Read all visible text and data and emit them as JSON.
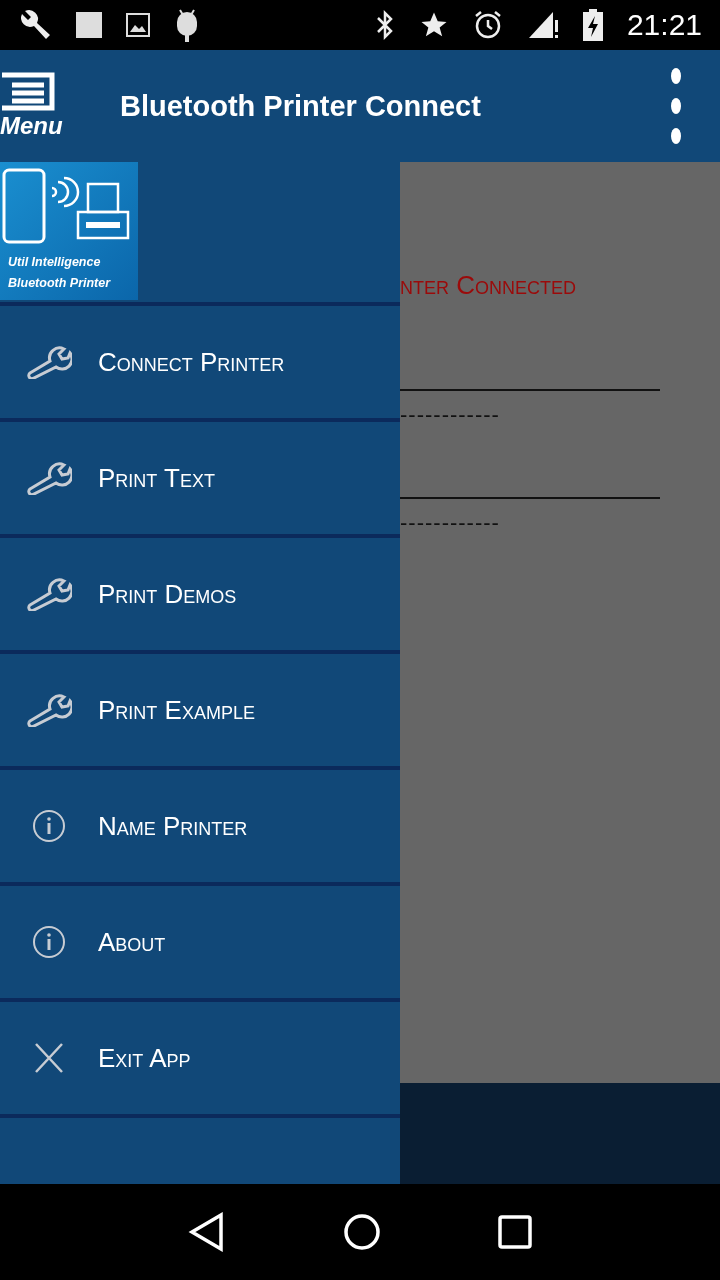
{
  "status_bar": {
    "time": "21:21"
  },
  "app_bar": {
    "menu_label": "Menu",
    "title": "Bluetooth Printer Connect"
  },
  "content": {
    "status": "nter Connected",
    "rows": [
      {
        "dashes": "------------"
      },
      {
        "dashes": "------------"
      }
    ]
  },
  "drawer": {
    "logo": {
      "line_1": "Util Intelligence",
      "line_2": "Bluetooth Printer"
    },
    "items": [
      {
        "kind": "wrench",
        "label": "Connect Printer"
      },
      {
        "kind": "wrench",
        "label": "Print Text"
      },
      {
        "kind": "wrench",
        "label": "Print Demos"
      },
      {
        "kind": "wrench",
        "label": "Print Example"
      },
      {
        "kind": "info",
        "label": "Name Printer"
      },
      {
        "kind": "info",
        "label": "About"
      },
      {
        "kind": "close",
        "label": "Exit App"
      }
    ]
  }
}
